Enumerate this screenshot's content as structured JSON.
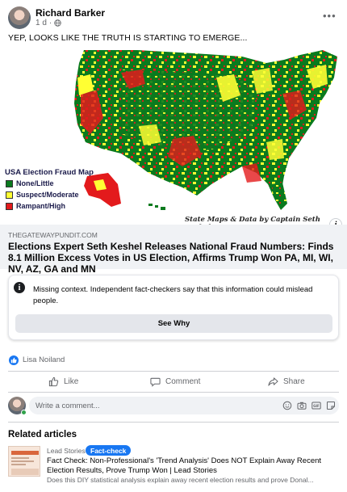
{
  "post": {
    "author": "Richard Barker",
    "time": "1 d",
    "text": "YEP, LOOKS LIKE THE TRUTH IS STARTING TO EMERGE..."
  },
  "map_image": {
    "legend_title": "USA Election Fraud Map",
    "legend": [
      {
        "label": "None/Little",
        "color": "#0a7a1e"
      },
      {
        "label": "Suspect/Moderate",
        "color": "#ffff33"
      },
      {
        "label": "Rampant/High",
        "color": "#e31a1c"
      }
    ],
    "credit": "State Maps & Data by Captain Seth Keshel"
  },
  "link": {
    "domain": "THEGATEWAYPUNDIT.COM",
    "title": "Elections Expert Seth Keshel Releases National Fraud Numbers: Finds 8.1 Million Excess Votes in US Election, Affirms Trump Won PA, MI, WI, NV, AZ, GA and MN"
  },
  "fact_check": {
    "heading": "Missing context.",
    "body": " Independent fact-checkers say that this information could mislead people.",
    "button": "See Why"
  },
  "reactions": {
    "names": "Lisa Noiland"
  },
  "actions": {
    "like": "Like",
    "comment": "Comment",
    "share": "Share"
  },
  "comment_input": {
    "placeholder": "Write a comment..."
  },
  "related": {
    "heading": "Related articles",
    "source": "Lead Stories",
    "badge": "Fact-check",
    "title": "Fact Check: Non-Professional's 'Trend Analysis' Does NOT Explain Away Recent Election Results, Prove Trump Won | Lead Stories",
    "description": "Does this DIY statistical analysis explain away recent election results and prove Donal..."
  },
  "colors": {
    "accent": "#1877f2",
    "secondary_text": "#65676b",
    "map_green": "#0a7a1e",
    "map_yellow": "#ffff33",
    "map_red": "#e31a1c"
  }
}
